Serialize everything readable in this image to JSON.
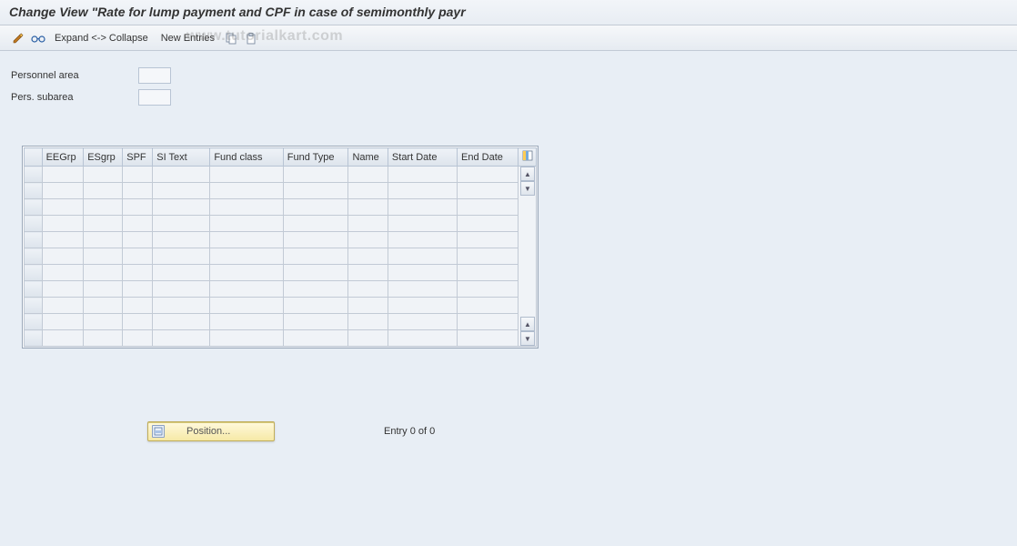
{
  "title": "Change View \"Rate for lump payment and CPF in case of semimonthly payr",
  "toolbar": {
    "expand_collapse": "Expand <-> Collapse",
    "new_entries": "New Entries"
  },
  "watermark": "www.tutorialkart.com",
  "fields": {
    "personnel_area_label": "Personnel area",
    "personnel_area_value": "",
    "pers_subarea_label": "Pers. subarea",
    "pers_subarea_value": ""
  },
  "table": {
    "columns": [
      "EEGrp",
      "ESgrp",
      "SPF",
      "SI Text",
      "Fund class",
      "Fund Type",
      "Name",
      "Start Date",
      "End Date"
    ],
    "row_count": 11
  },
  "footer": {
    "position_label": "Position...",
    "entry_text": "Entry 0 of 0"
  }
}
